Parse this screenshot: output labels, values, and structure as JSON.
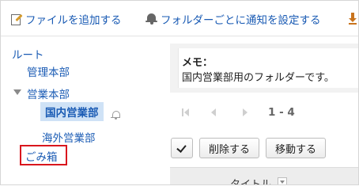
{
  "toolbar": {
    "add_file_label": "ファイルを追加する",
    "notify_label": "フォルダーごとに通知を設定する"
  },
  "icons": {
    "add_file": "file-edit-icon",
    "notify": "bell-icon",
    "more": "download-icon",
    "folder_notify": "bell-outline-icon",
    "expand": "triangle-down-icon"
  },
  "tree": {
    "root": "ルート",
    "items": [
      {
        "label": "管理本部"
      },
      {
        "label": "営業本部"
      },
      {
        "label": "国内営業部"
      },
      {
        "label": "海外営業部"
      }
    ],
    "trash": "ごみ箱"
  },
  "memo": {
    "title": "メモ：",
    "text": "国内営業部用のフォルダーです。"
  },
  "pager": {
    "range": "1 - 4"
  },
  "actions": {
    "delete_label": "削除する",
    "move_label": "移動する"
  },
  "table": {
    "title_header": "タイトル"
  },
  "colors": {
    "link": "#1a5bb4",
    "selected_bg": "#cfe2f6",
    "highlight_border": "#d9161d"
  }
}
